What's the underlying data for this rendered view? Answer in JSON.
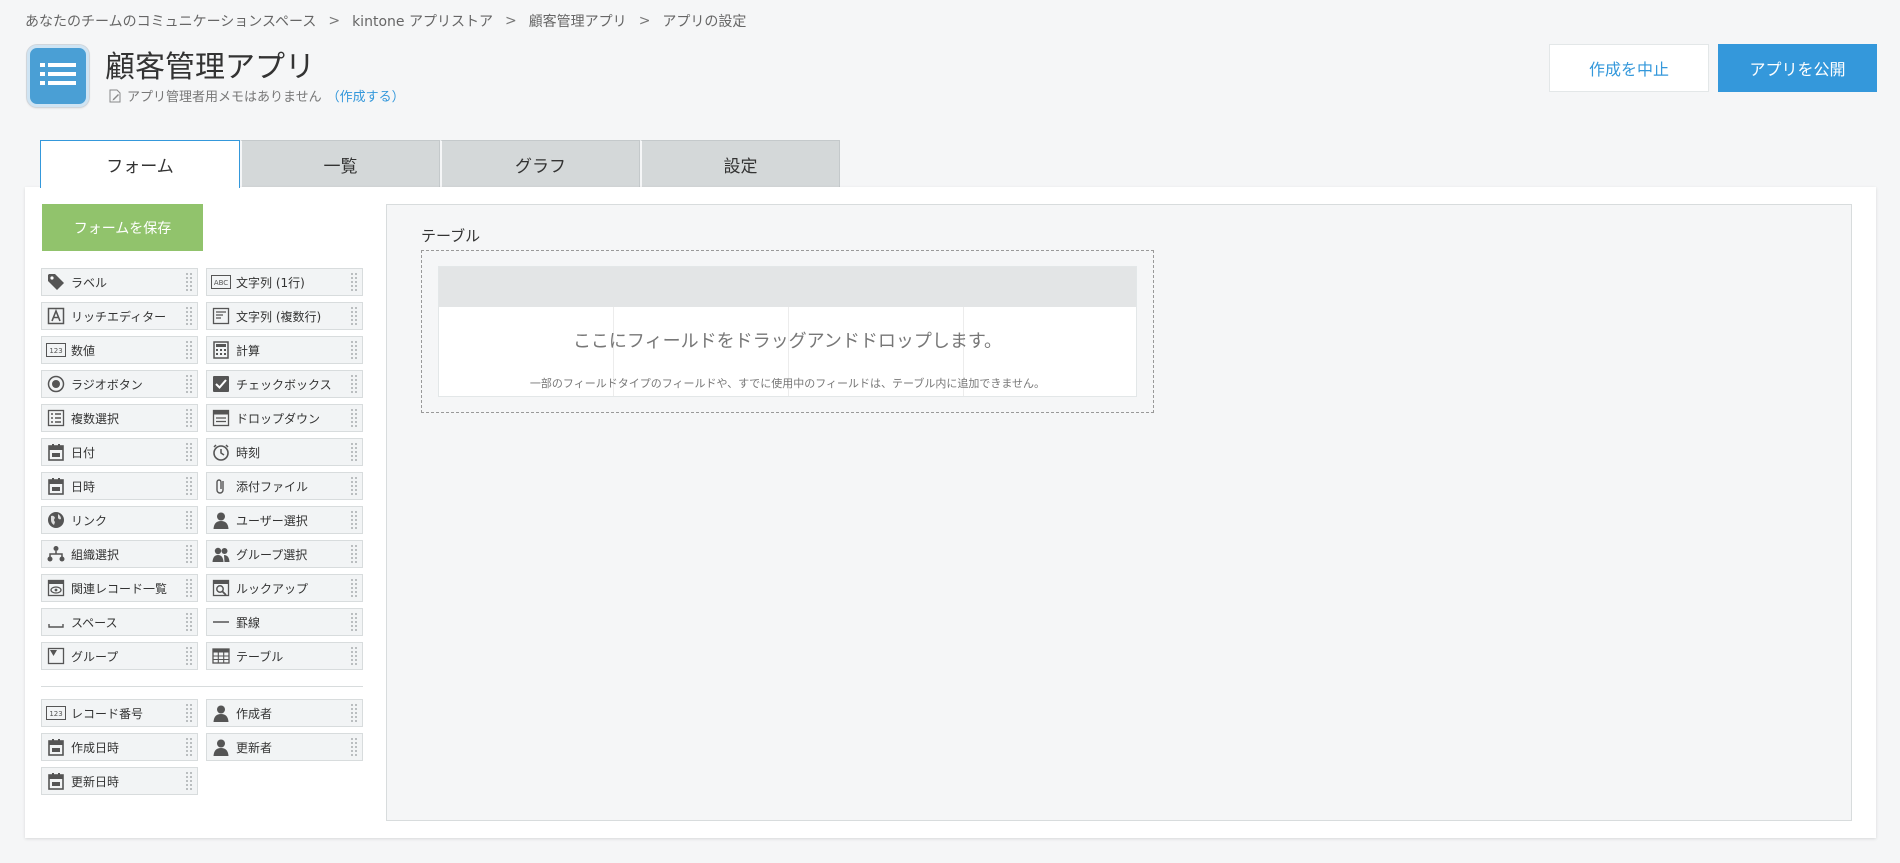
{
  "breadcrumb": {
    "items": [
      "あなたのチームのコミュニケーションスペース",
      "kintone アプリストア",
      "顧客管理アプリ",
      "アプリの設定"
    ],
    "separator": ">"
  },
  "header": {
    "title": "顧客管理アプリ",
    "memo_text": "アプリ管理者用メモはありません",
    "memo_link": "（作成する）",
    "cancel_label": "作成を中止",
    "publish_label": "アプリを公開"
  },
  "tabs": [
    {
      "label": "フォーム",
      "active": true
    },
    {
      "label": "一覧",
      "active": false
    },
    {
      "label": "グラフ",
      "active": false
    },
    {
      "label": "設定",
      "active": false
    }
  ],
  "form": {
    "save_label": "フォームを保存",
    "palette": [
      {
        "label": "ラベル",
        "icon": "tag-icon"
      },
      {
        "label": "文字列 (1行)",
        "icon": "abc-icon"
      },
      {
        "label": "リッチエディター",
        "icon": "rich-text-icon"
      },
      {
        "label": "文字列 (複数行)",
        "icon": "multiline-icon"
      },
      {
        "label": "数値",
        "icon": "number-icon"
      },
      {
        "label": "計算",
        "icon": "calculator-icon"
      },
      {
        "label": "ラジオボタン",
        "icon": "radio-icon"
      },
      {
        "label": "チェックボックス",
        "icon": "checkbox-icon"
      },
      {
        "label": "複数選択",
        "icon": "multi-select-icon"
      },
      {
        "label": "ドロップダウン",
        "icon": "dropdown-icon"
      },
      {
        "label": "日付",
        "icon": "calendar-icon"
      },
      {
        "label": "時刻",
        "icon": "clock-icon"
      },
      {
        "label": "日時",
        "icon": "calendar-icon"
      },
      {
        "label": "添付ファイル",
        "icon": "paperclip-icon"
      },
      {
        "label": "リンク",
        "icon": "globe-icon"
      },
      {
        "label": "ユーザー選択",
        "icon": "user-icon"
      },
      {
        "label": "組織選択",
        "icon": "org-icon"
      },
      {
        "label": "グループ選択",
        "icon": "group-icon"
      },
      {
        "label": "関連レコード一覧",
        "icon": "related-records-icon"
      },
      {
        "label": "ルックアップ",
        "icon": "lookup-icon"
      },
      {
        "label": "スペース",
        "icon": "space-icon"
      },
      {
        "label": "罫線",
        "icon": "line-icon"
      },
      {
        "label": "グループ",
        "icon": "group-field-icon"
      },
      {
        "label": "テーブル",
        "icon": "table-icon"
      }
    ],
    "system_palette": [
      {
        "label": "レコード番号",
        "icon": "number-icon"
      },
      {
        "label": "作成者",
        "icon": "user-icon"
      },
      {
        "label": "作成日時",
        "icon": "calendar-icon"
      },
      {
        "label": "更新者",
        "icon": "user-icon"
      },
      {
        "label": "更新日時",
        "icon": "calendar-icon"
      }
    ]
  },
  "canvas": {
    "table_label": "テーブル",
    "drop_text": "ここにフィールドをドラッグアンドドロップします。",
    "drop_note": "一部のフィールドタイプのフィールドや、すでに使用中のフィールドは、テーブル内に追加できません。"
  },
  "colors": {
    "accent": "#3498db",
    "save": "#91c36c",
    "icon": "#555555"
  }
}
